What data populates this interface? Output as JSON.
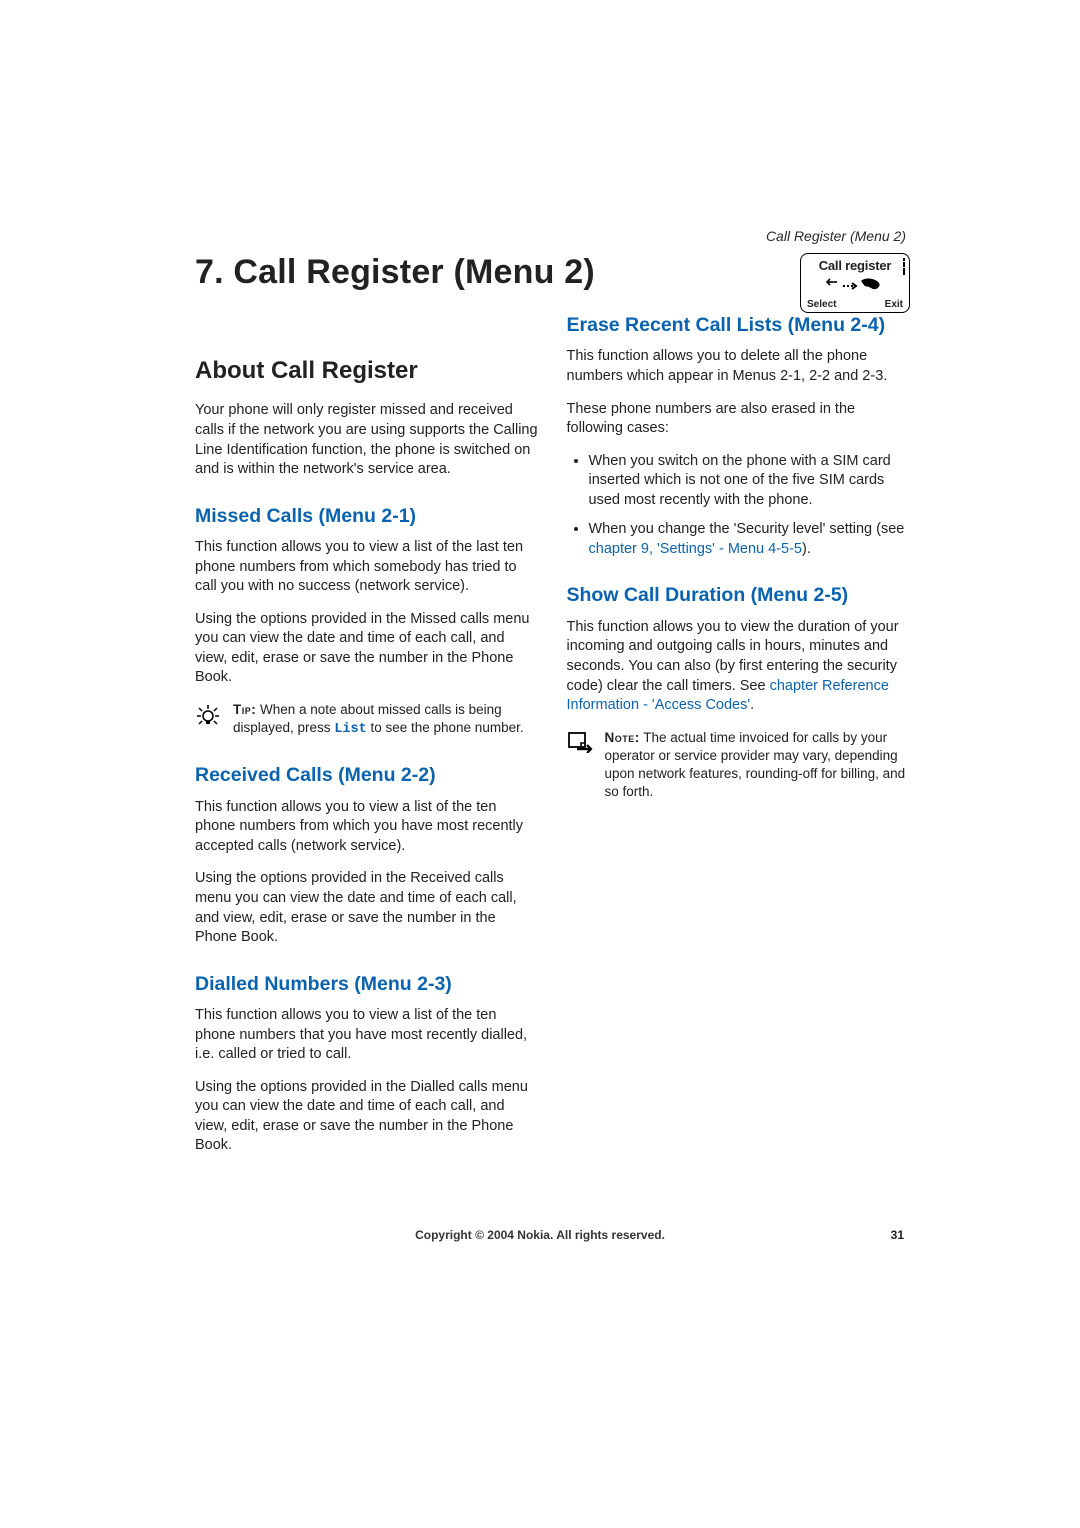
{
  "running_head": "Call Register (Menu 2)",
  "chapter_title": "7. Call Register (Menu 2)",
  "phone_screen": {
    "title": "Call register",
    "left_softkey": "Select",
    "right_softkey": "Exit"
  },
  "about": {
    "heading": "About Call Register",
    "p1": "Your phone will only register missed and received calls if the network you are using supports the Calling Line Identification function, the phone is switched on and is within the network's service area."
  },
  "missed": {
    "heading": "Missed Calls (Menu 2-1)",
    "p1": "This function allows you to view a list of the last ten phone numbers from which somebody has tried to call you with no success (network service).",
    "p2": "Using the options provided in the Missed calls menu you can view the date and time of each call, and view, edit, erase or save the number in the Phone Book.",
    "tip_label": "Tip:",
    "tip_before": " When a note about missed calls is being displayed, press ",
    "tip_code": "List",
    "tip_after": " to see the phone number."
  },
  "received": {
    "heading": "Received Calls (Menu 2-2)",
    "p1": "This function allows you to view a list of the ten phone numbers from which you have most recently accepted calls (network service).",
    "p2": "Using the options provided in the Received calls menu you can view the date and time of each call, and view, edit, erase or save the number in the Phone Book."
  },
  "dialled": {
    "heading": "Dialled Numbers (Menu 2-3)",
    "p1": "This function allows you to view a list of the ten phone numbers that you have most recently dialled, i.e. called or tried to call.",
    "p2": "Using the options provided in the Dialled calls menu you can view the date and time of each call, and view, edit, erase or save the number in the Phone Book."
  },
  "erase": {
    "heading": "Erase Recent Call Lists (Menu 2-4)",
    "p1": "This function allows you to delete all the phone numbers which appear in Menus 2-1, 2-2 and 2-3.",
    "p2": "These phone numbers are also erased in the following cases:",
    "bullet1": "When you switch on the phone with a SIM card inserted which is not one of the five SIM cards used most recently with the phone.",
    "bullet2_before": "When you change the 'Security level' setting (see ",
    "bullet2_link": "chapter 9, 'Settings' - Menu 4-5-5",
    "bullet2_after": ")."
  },
  "duration": {
    "heading": "Show Call Duration (Menu 2-5)",
    "p1_before": "This function allows you to view the duration of your incoming and outgoing calls in hours, minutes and seconds. You can also (by first entering the security code) clear the call timers. See ",
    "p1_link": "chapter Reference Information - 'Access Codes'",
    "p1_after": ".",
    "note_label": "Note:",
    "note_text": " The actual time invoiced for calls by your operator or service provider may vary, depending upon network features, rounding-off for billing, and so forth."
  },
  "footer": "Copyright © 2004 Nokia. All rights reserved.",
  "page_number": "31"
}
